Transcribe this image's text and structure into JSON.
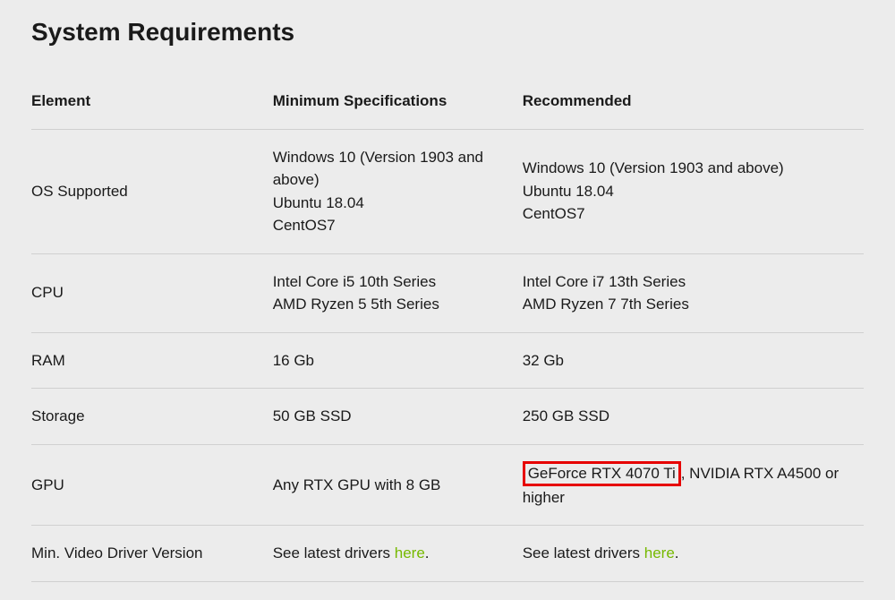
{
  "title": "System Requirements",
  "headers": {
    "element": "Element",
    "min": "Minimum Specifications",
    "rec": "Recommended"
  },
  "rows": {
    "os": {
      "label": "OS Supported",
      "min_line1": "Windows 10 (Version 1903 and above)",
      "min_line2": "Ubuntu 18.04",
      "min_line3": "CentOS7",
      "rec_line1": "Windows 10 (Version 1903 and above)",
      "rec_line2": "Ubuntu 18.04",
      "rec_line3": "CentOS7"
    },
    "cpu": {
      "label": "CPU",
      "min_line1": "Intel Core i5 10th Series",
      "min_line2": "AMD Ryzen 5 5th Series",
      "rec_line1": "Intel Core i7 13th Series",
      "rec_line2": "AMD Ryzen 7 7th Series"
    },
    "ram": {
      "label": "RAM",
      "min": "16 Gb",
      "rec": "32 Gb"
    },
    "storage": {
      "label": "Storage",
      "min": "50 GB SSD",
      "rec": "250 GB SSD"
    },
    "gpu": {
      "label": "GPU",
      "min": "Any RTX GPU with 8 GB",
      "rec_highlight": "GeForce RTX 4070 Ti",
      "rec_rest": ", NVIDIA RTX A4500 or higher"
    },
    "driver": {
      "label": "Min. Video Driver Version",
      "prefix": "See latest drivers ",
      "link": "here",
      "suffix": "."
    }
  }
}
